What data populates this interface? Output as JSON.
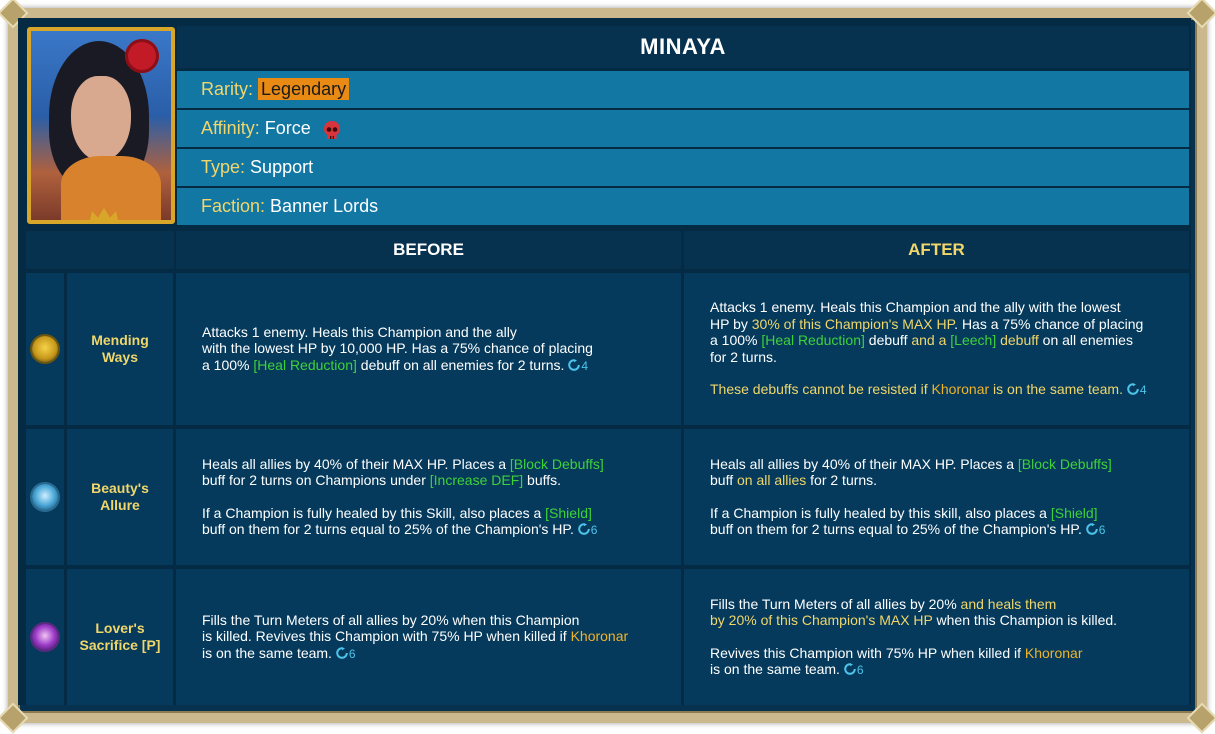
{
  "champion": {
    "name": "MINAYA",
    "rarity_label": "Rarity:",
    "rarity": "Legendary",
    "rarity_color": "#e88a14",
    "affinity_label": "Affinity:",
    "affinity": "Force",
    "affinity_icon": "skull-icon",
    "type_label": "Type:",
    "type": "Support",
    "faction_label": "Faction:",
    "faction": "Banner Lords"
  },
  "table": {
    "before_header": "BEFORE",
    "after_header": "AFTER",
    "skills": [
      {
        "name_line1": "Mending",
        "name_line2": "Ways",
        "icon": "mending-ways-icon",
        "before": {
          "p1_a": "Attacks 1 enemy. Heals this Champion and the ally",
          "p1_b": "with the lowest HP by 10,000 HP. Has a 75% chance of placing",
          "p1_c": "a 100%",
          "p1_d": "[Heal Reduction]",
          "p1_e": "debuff on all enemies for 2 turns.",
          "cooldown": "4"
        },
        "after": {
          "p1_a": "Attacks 1 enemy. Heals this Champion and the ally with the lowest",
          "p1_b": "HP by",
          "p1_c": "30% of this Champion's MAX HP",
          "p1_d": ". Has a 75% chance of placing",
          "p1_e": "a 100%",
          "p1_f": "[Heal Reduction]",
          "p1_g": "debuff",
          "p1_h": "and a",
          "p1_i": "[Leech]",
          "p1_j": "debuff",
          "p1_k": "on all enemies",
          "p1_l": "for 2 turns.",
          "p2_a": "These debuffs cannot be resisted if",
          "p2_b": "Khoronar",
          "p2_c": "is on the same team.",
          "cooldown": "4"
        }
      },
      {
        "name_line1": "Beauty's",
        "name_line2": "Allure",
        "icon": "beautys-allure-icon",
        "before": {
          "p1_a": "Heals all allies by 40% of their MAX HP. Places a",
          "p1_b": "[Block Debuffs]",
          "p1_c": "buff for 2 turns on Champions under",
          "p1_d": "[Increase DEF]",
          "p1_e": "buffs.",
          "p2_a": "If a Champion is fully healed by this Skill, also places a",
          "p2_b": "[Shield]",
          "p2_c": "buff on them for 2 turns equal to 25% of the Champion's HP.",
          "cooldown": "6"
        },
        "after": {
          "p1_a": "Heals all allies by 40% of their MAX HP. Places a",
          "p1_b": "[Block Debuffs]",
          "p1_c": "buff",
          "p1_d": "on all allies",
          "p1_e": "for 2 turns.",
          "p2_a": "If a Champion is fully healed by this skill, also places a",
          "p2_b": "[Shield]",
          "p2_c": "buff on them for 2 turns equal to 25% of the Champion's HP.",
          "cooldown": "6"
        }
      },
      {
        "name_line1": "Lover's",
        "name_line2": "Sacrifice [P]",
        "icon": "lovers-sacrifice-icon",
        "before": {
          "p1_a": "Fills the Turn Meters of all allies by 20% when this Champion",
          "p1_b": "is killed. Revives this Champion with 75% HP when killed if",
          "p1_c": "Khoronar",
          "p1_d": "is on the same team.",
          "cooldown": "6"
        },
        "after": {
          "p1_a": "Fills the Turn Meters of all allies by 20%",
          "p1_b": "and heals them",
          "p1_c": "by 20% of this Champion's MAX HP",
          "p1_d": "when this Champion is killed.",
          "p2_a": "Revives this Champion with 75% HP when killed if",
          "p2_b": "Khoronar",
          "p2_c": "is on the same team.",
          "cooldown": "6"
        }
      }
    ]
  }
}
